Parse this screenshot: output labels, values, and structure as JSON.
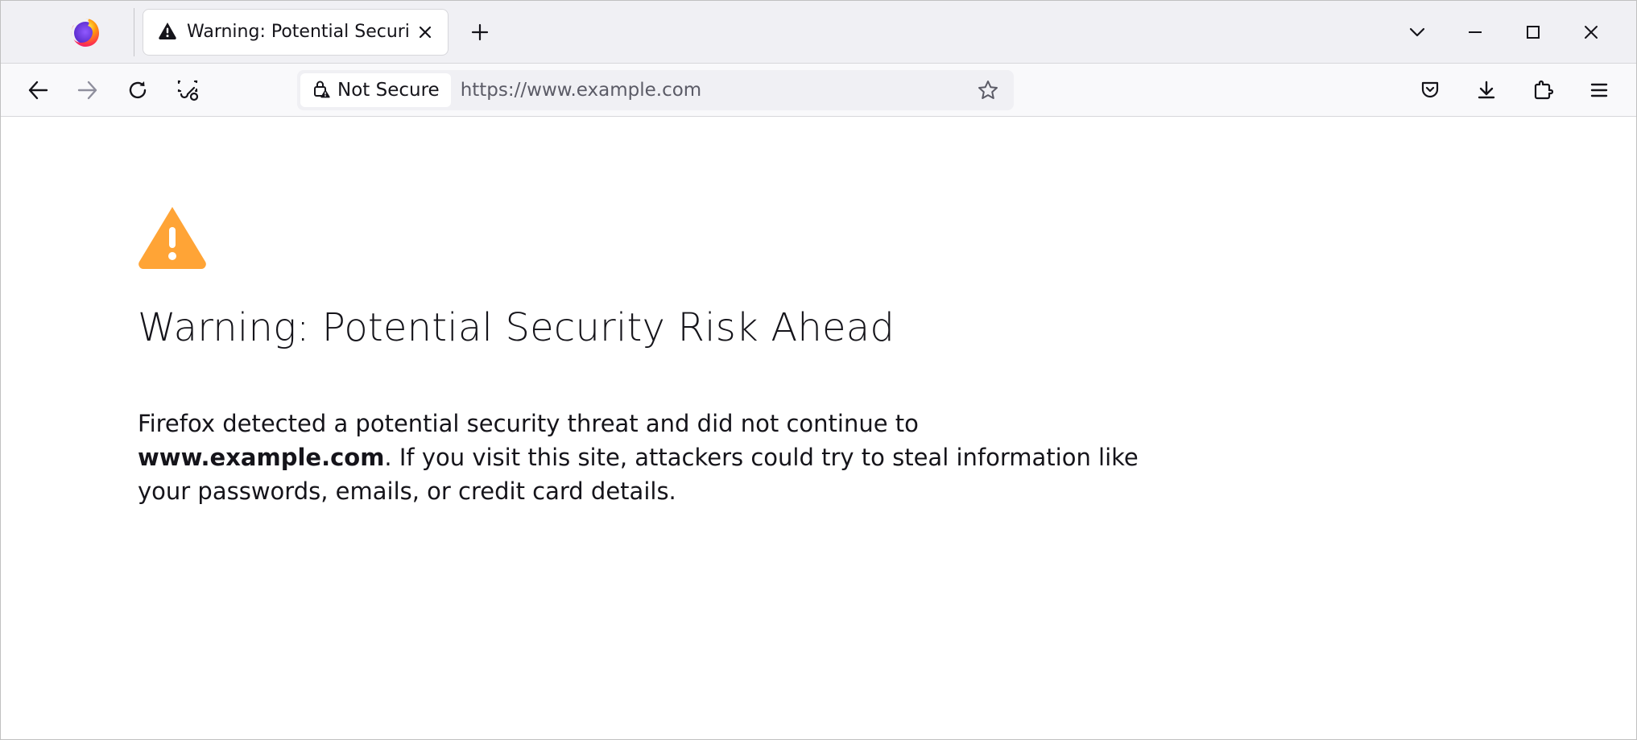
{
  "tab": {
    "title": "Warning: Potential Security Risk"
  },
  "urlbar": {
    "not_secure_label": "Not Secure",
    "url": "https://www.example.com"
  },
  "page": {
    "heading": "Warning: Potential Security Risk Ahead",
    "desc_before": "Firefox detected a potential security threat and did not continue to ",
    "host": "www.example.com",
    "desc_after": ". If you visit this site, attackers could try to steal information like your passwords, emails, or credit card details."
  }
}
